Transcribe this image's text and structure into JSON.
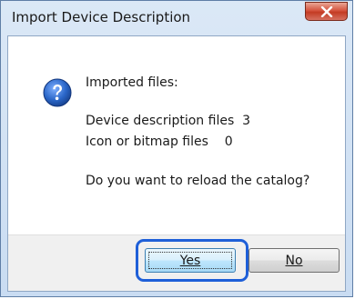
{
  "window": {
    "title": "Import Device Description"
  },
  "icons": {
    "message_icon": "question-mark-icon",
    "close_icon": "close-icon"
  },
  "message": {
    "heading": "Imported files:",
    "device_description_line": "Device description files  3",
    "icon_bitmap_line": "Icon or bitmap files    0",
    "question": "Do you want to reload the catalog?"
  },
  "buttons": {
    "yes_label": "Yes",
    "no_label": "No"
  },
  "colors": {
    "highlight": "#1e5fd8",
    "icon_blue": "#1f5fbf",
    "close_red": "#c8402a"
  }
}
